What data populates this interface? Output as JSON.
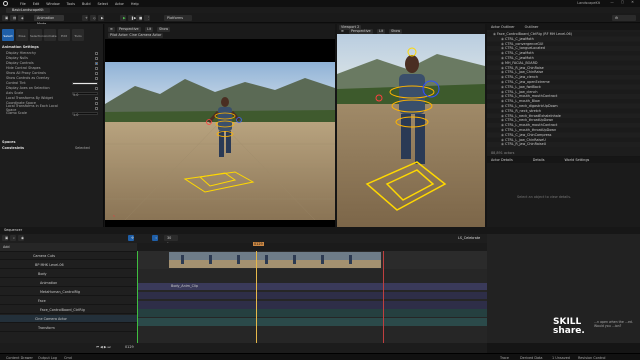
{
  "menu": {
    "items": [
      "File",
      "Edit",
      "Window",
      "Tools",
      "Build",
      "Select",
      "Actor",
      "Help"
    ],
    "project_name": "LandscapeKit"
  },
  "level_tab": "BasicLandscapeKit",
  "toolbar": {
    "mode": "Animation Mode",
    "platforms": "Platforms"
  },
  "left_panel": {
    "modes": [
      "Select",
      "Pose",
      "Selection",
      "Animate",
      "Edit",
      "Tools"
    ],
    "section_anim": "Animation Settings",
    "rows": [
      "Display Hierarchy",
      "Display Nulls",
      "Display Controls",
      "Hide Control Shapes",
      "Show All Proxy Controls",
      "Show Controls as Overlay",
      "Control Tint",
      "Display Axes on Selection",
      "Axis Scale",
      "Local Transforms By Widget",
      "Coordinate Space",
      "Local Transforms in Each Local Space",
      "Gizmo Scale"
    ],
    "axis_scale": "5.0",
    "gizmo_scale": "1.0",
    "section_spaces": "Spaces",
    "section_constraints": "Constraints",
    "constraints_value": "Selected"
  },
  "viewport1": {
    "view": "Perspective",
    "lit": "Lit",
    "show": "Show",
    "pilot": "Pilot Actor: Cine Camera Actor",
    "stat": "5"
  },
  "viewport2": {
    "title": "Viewport 2",
    "view": "Perspective",
    "lit": "Lit",
    "show": "Show"
  },
  "outliner": {
    "tabs": [
      "Actor Outliner",
      "Outliner"
    ],
    "rows": [
      {
        "label": "Face_ControlBoard_CtrlRig (RF MH Level-06)",
        "cls": ""
      },
      {
        "label": "CTRL_C_jawMoth",
        "cls": ""
      },
      {
        "label": "CTRL_convergenceGUI",
        "cls": ""
      },
      {
        "label": "CTRL_C_tongueLocated",
        "cls": ""
      },
      {
        "label": "CTRL_C_jawMoth",
        "cls": ""
      },
      {
        "label": "CTRL_C_jawMoth",
        "cls": ""
      },
      {
        "label": "MH_FACIAL_BOARD",
        "cls": ""
      },
      {
        "label": "CTRL_R_jaw_ChinRaise",
        "cls": ""
      },
      {
        "label": "CTRL_L_jaw_ChinRaise",
        "cls": ""
      },
      {
        "label": "CTRL_C_jaw_clench",
        "cls": ""
      },
      {
        "label": "CTRL_C_jaw_openExtreme",
        "cls": ""
      },
      {
        "label": "CTRL_L_jaw_fwdBack",
        "cls": ""
      },
      {
        "label": "CTRL_L_jaw_clench",
        "cls": ""
      },
      {
        "label": "CTRL_L_mouth_mouthContract",
        "cls": ""
      },
      {
        "label": "CTRL_L_mouth_Blow",
        "cls": ""
      },
      {
        "label": "CTRL_L_neck_digastricUpDown",
        "cls": ""
      },
      {
        "label": "CTRL_R_neck_stretch",
        "cls": ""
      },
      {
        "label": "CTRL_L_neck_throatExhaleInhale",
        "cls": ""
      },
      {
        "label": "CTRL_L_neck_throatUpDown",
        "cls": ""
      },
      {
        "label": "CTRL_L_mouth_mouthContract",
        "cls": ""
      },
      {
        "label": "CTRL_L_mouth_throatUpDown",
        "cls": ""
      },
      {
        "label": "CTRL_C_jaw_ChinCompress",
        "cls": ""
      },
      {
        "label": "CTRL_L_jaw_ChinRaiseU",
        "cls": ""
      },
      {
        "label": "CTRL_R_jaw_ChinRaiseU",
        "cls": ""
      }
    ],
    "actor_count": "88,891 actors"
  },
  "details": {
    "tabs": [
      "Actor Details",
      "Details",
      "World Settings"
    ],
    "empty": "Select an object to view details."
  },
  "sequencer": {
    "tab": "Sequencer",
    "sequence_name": "LS_Celebrate",
    "fps": "30 fps",
    "frame": "0129",
    "tracks": [
      "Camera Cuts",
      "BP MHK Level-06",
      "Body",
      "Animation",
      "MetaHuman_ControlRig",
      "Face",
      "Face_ControlBoard_CtrlRig",
      "Cine Camera Actor",
      "Transform"
    ],
    "add_label": "Add",
    "anim_label": "Body_Anim_Clip"
  },
  "status": {
    "items": [
      "Content Drawer",
      "Output Log",
      "Cmd"
    ],
    "source": "Source Control",
    "revision": "Revision Control",
    "unsaved": "1 Unsaved",
    "trace": "Trace",
    "derived": "Derived Data"
  },
  "watermark": {
    "brand_top": "SKILL",
    "brand_bottom": "share.",
    "text": "...n open when the ...ed. Would you ...ion?"
  }
}
